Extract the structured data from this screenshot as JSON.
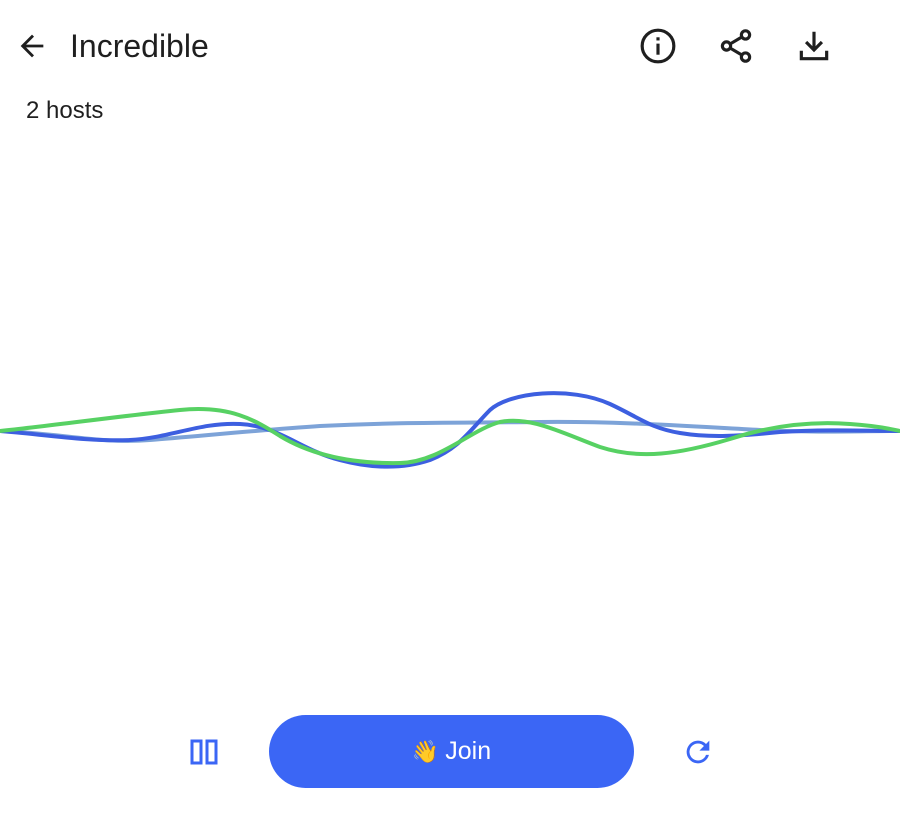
{
  "header": {
    "title": "Incredible",
    "back_icon": "arrow-left-icon",
    "actions": [
      {
        "name": "info",
        "icon": "info-icon"
      },
      {
        "name": "share",
        "icon": "share-icon"
      },
      {
        "name": "download",
        "icon": "download-icon"
      }
    ]
  },
  "space": {
    "host_count_text": "2 hosts"
  },
  "waveform": {
    "colors": {
      "primary": "#3d5fe0",
      "secondary": "#7da3d8",
      "accent": "#57d163"
    }
  },
  "controls": {
    "pause_icon": "pause-icon",
    "join_emoji": "👋",
    "join_label": "Join",
    "join_color": "#3b66f5",
    "refresh_icon": "refresh-icon"
  }
}
